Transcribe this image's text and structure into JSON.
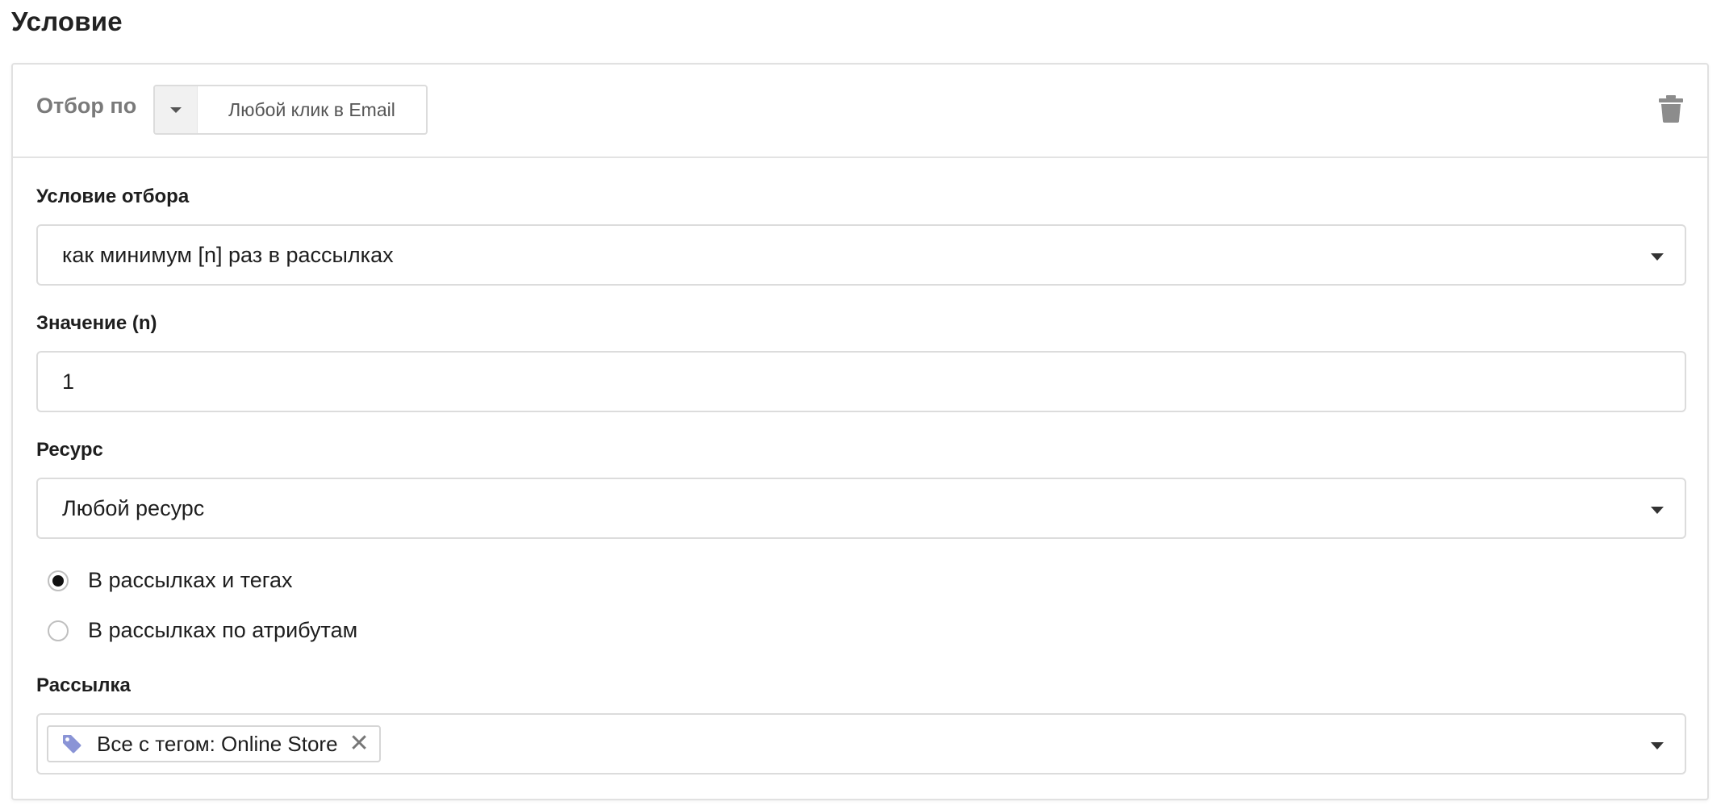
{
  "page": {
    "title": "Условие"
  },
  "header": {
    "filter_label": "Отбор по",
    "filter_value": "Любой клик в Email"
  },
  "condition": {
    "label": "Условие отбора",
    "value": "как минимум [n] раз в рассылках"
  },
  "amount": {
    "label": "Значение (n)",
    "value": "1"
  },
  "resource": {
    "label": "Ресурс",
    "value": "Любой ресурс"
  },
  "mode_options": [
    {
      "label": "В рассылках и тегах",
      "checked": true
    },
    {
      "label": "В рассылках по атрибутам",
      "checked": false
    }
  ],
  "mailing": {
    "label": "Рассылка",
    "tag_label": "Все с тегом: Online Store",
    "tag_remove": "✕"
  },
  "icons": {
    "trash": "trash-icon",
    "tag": "tag-icon",
    "caret": "caret-down-icon"
  },
  "colors": {
    "tag_icon": "#8a94d6",
    "trash_icon": "#8c8c8c",
    "muted_label": "#7a7a7a"
  }
}
